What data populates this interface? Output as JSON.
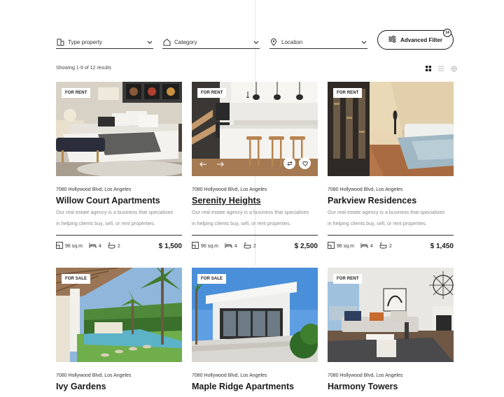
{
  "filters": {
    "type_label": "Type property",
    "category_label": "Category",
    "location_label": "Location",
    "advanced_label": "Advanced Filter",
    "advanced_count": "14"
  },
  "results_text": "Showing 1-9 of 12 results",
  "view_icons": [
    "grid-icon",
    "list-icon",
    "map-icon"
  ],
  "listings": [
    {
      "badge": "FOR RENT",
      "address": "7080 Hollywood Blvd, Los Angeles",
      "title": "Willow Court Apartments",
      "description_line1": "Our real estate agency is a business that specializes",
      "description_line2": "in helping clients buy, sell, or rent properties.",
      "area": "96 sq.m",
      "beds": "4",
      "baths": "2",
      "price": "$ 1,500"
    },
    {
      "badge": "FOR RENT",
      "address": "7080 Hollywood Blvd, Los Angeles",
      "title": "Serenity Heights",
      "description_line1": "Our real estate agency is a business that specializes",
      "description_line2": "in helping clients buy, sell, or rent properties.",
      "area": "96 sq.m",
      "beds": "4",
      "baths": "2",
      "price": "$ 2,500"
    },
    {
      "badge": "FOR RENT",
      "address": "7080 Hollywood Blvd, Los Angeles",
      "title": "Parkview Residences",
      "description_line1": "Our real estate agency is a business that specializes",
      "description_line2": "in helping clients buy, sell, or rent properties.",
      "area": "96 sq.m",
      "beds": "4",
      "baths": "2",
      "price": "$ 1,450"
    },
    {
      "badge": "FOR SALE",
      "address": "7080 Hollywood Blvd, Los Angeles",
      "title": "Ivy Gardens"
    },
    {
      "badge": "FOR SALE",
      "address": "7080 Hollywood Blvd, Los Angeles",
      "title": "Maple Ridge Apartments"
    },
    {
      "badge": "FOR RENT",
      "address": "7080 Hollywood Blvd, Los Angeles",
      "title": "Harmony Towers"
    }
  ],
  "colors": {
    "text": "#1a1a1a",
    "muted": "#8a8a8a",
    "line": "#333333"
  }
}
